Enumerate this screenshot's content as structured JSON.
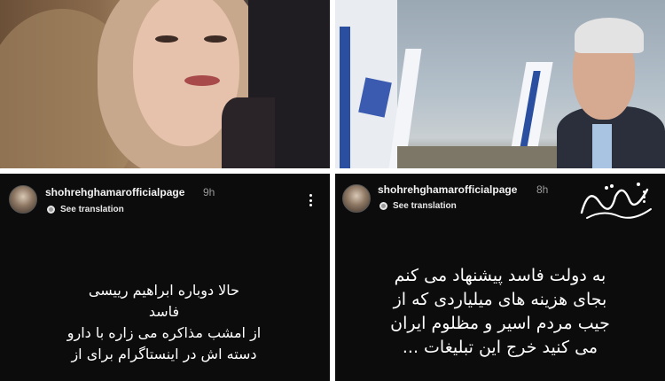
{
  "stories": [
    {
      "username": "shohrehghamarofficialpage",
      "time": "9h",
      "translation_label": "See translation",
      "lines": [
        "حالا دوباره ابراهیم رییسی",
        "فاسد",
        "از امشب مذاکره می زاره با دارو",
        "دسته اش در اینستاگرام برای از"
      ]
    },
    {
      "username": "shohrehghamarofficialpage",
      "time": "8h",
      "translation_label": "See translation",
      "lines": [
        "به دولت فاسد پیشنهاد می کنم",
        "بجای هزینه های میلیاردی که از",
        "جیب مردم اسیر و مظلوم ایران",
        "می کنید خرج این تبلیغات ..."
      ]
    }
  ],
  "colors": {
    "story_background": "#0c0c0c",
    "text": "#ffffff",
    "timestamp": "#9a9a9a"
  },
  "icons": [
    "avatar",
    "globe-icon",
    "more-vertical-icon",
    "calligraphy-watermark"
  ]
}
